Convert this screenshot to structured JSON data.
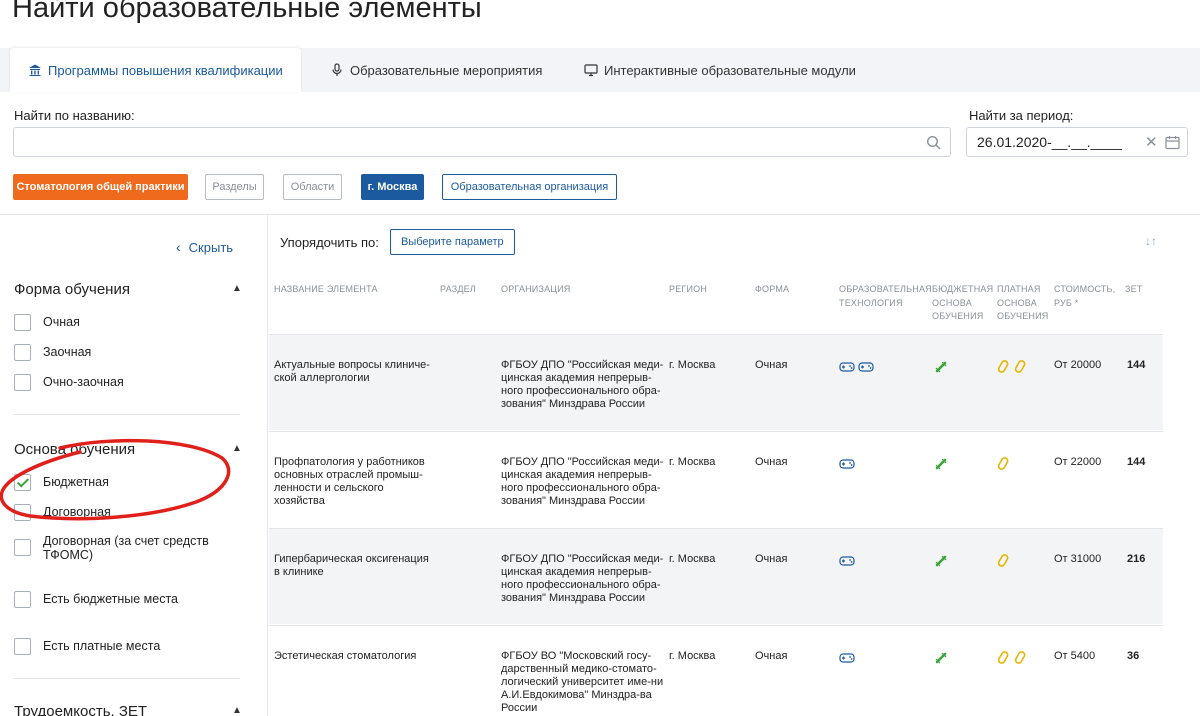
{
  "page": {
    "title": "Найти образовательные элементы"
  },
  "tabs": [
    {
      "label": "Программы повышения квалификации",
      "icon": "bank-icon"
    },
    {
      "label": "Образовательные мероприятия",
      "icon": "microphone-icon"
    },
    {
      "label": "Интерактивные образовательные модули",
      "icon": "monitor-icon"
    }
  ],
  "search": {
    "name_label": "Найти по названию:",
    "name_value": "",
    "period_label": "Найти за период:",
    "period_value": "26.01.2020-__.__.____"
  },
  "chips": {
    "specialty": "Стоматология общей практики",
    "sections": "Разделы",
    "areas": "Области",
    "region": "г. Москва",
    "organization": "Образовательная организация"
  },
  "sidebar": {
    "hide": "Скрыть",
    "form": {
      "title": "Форма обучения",
      "options": [
        {
          "label": "Очная",
          "checked": false
        },
        {
          "label": "Заочная",
          "checked": false
        },
        {
          "label": "Очно-заочная",
          "checked": false
        }
      ]
    },
    "basis": {
      "title": "Основа обучения",
      "options": [
        {
          "label": "Бюджетная",
          "checked": true
        },
        {
          "label": "Договорная",
          "checked": false
        },
        {
          "label": "Договорная (за счет средств ТФОМС)",
          "checked": false
        },
        {
          "label": "Есть бюджетные места",
          "checked": false
        },
        {
          "label": "Есть платные места",
          "checked": false
        }
      ]
    },
    "labor": {
      "title": "Трудоемкость, ЗЕТ"
    }
  },
  "main": {
    "sort_label": "Упорядочить по:",
    "sort_button": "Выберите параметр",
    "columns": {
      "name": "Название элемента",
      "section": "Раздел",
      "org": "Организация",
      "region": "Регион",
      "form": "Форма",
      "tech": "Образовательная технология",
      "budget": "Бюджетная основа обучения",
      "paid": "Платная основа обучения",
      "cost": "Стоимость, руб *",
      "zet": "ЗЕТ"
    },
    "rows": [
      {
        "name": "Актуальные вопросы клиниче-ской аллергологии",
        "org": "ФГБОУ ДПО \"Российская меди-цинская академия непрерыв-ного профессионального обра-зования\" Минздрава России",
        "region": "г. Москва",
        "form": "Очная",
        "cost": "От 20000",
        "zet": "144",
        "tech_icons": 2,
        "paid_icons": 2
      },
      {
        "name": "Профпатология у работников основных отраслей промыш-ленности и сельского хозяйства",
        "org": "ФГБОУ ДПО \"Российская меди-цинская академия непрерыв-ного профессионального обра-зования\" Минздрава России",
        "region": "г. Москва",
        "form": "Очная",
        "cost": "От 22000",
        "zet": "144",
        "tech_icons": 1,
        "paid_icons": 1
      },
      {
        "name": "Гипербарическая оксигенация в клинике",
        "org": "ФГБОУ ДПО \"Российская меди-цинская академия непрерыв-ного профессионального обра-зования\" Минздрава России",
        "region": "г. Москва",
        "form": "Очная",
        "cost": "От 31000",
        "zet": "216",
        "tech_icons": 1,
        "paid_icons": 1
      },
      {
        "name": "Эстетическая стоматология",
        "org": "ФГБОУ ВО \"Московский госу-дарственный медико-стомато-логический университет име-ни А.И.Евдокимова\" Минздра-ва России",
        "region": "г. Москва",
        "form": "Очная",
        "cost": "От 5400",
        "zet": "36",
        "tech_icons": 1,
        "paid_icons": 2
      }
    ]
  },
  "colors": {
    "accent": "#1c5aa0",
    "orange": "#f06a1e",
    "budget_icon": "#3aa33a",
    "paid_icon": "#e8b400",
    "annotation": "#e0201a"
  }
}
